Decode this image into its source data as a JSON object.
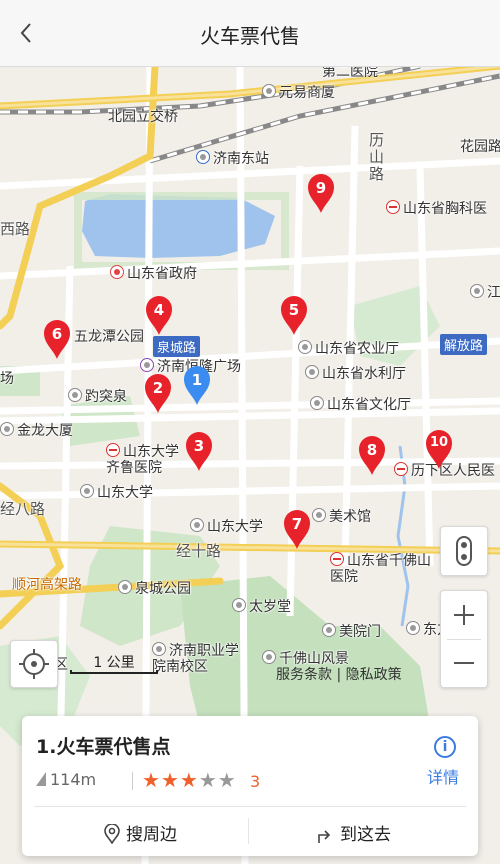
{
  "header": {
    "title": "火车票代售"
  },
  "map": {
    "labels": {
      "beiyuan": "北园立交桥",
      "dier": "第二医院",
      "yuanyi": "元易商厦",
      "jinandong": "济南东站",
      "huayuan": "花园路",
      "lishan": "历山路",
      "xiongke": "山东省胸科医",
      "xilu": "西路",
      "zhengfu": "山东省政府",
      "wulongtan": "五龙潭公园",
      "quancheng_road": "泉城路",
      "jiefang": "解放路",
      "hengLong": "济南恒隆广场",
      "nongye": "山东省农业厅",
      "shuili": "山东省水利厅",
      "baotu": "趵突泉",
      "wenhua": "山东省文化厅",
      "chang": "场",
      "jinlong": "金龙大厦",
      "qilu": "山东大学齐鲁医院",
      "renmin": "历下区人民医",
      "shanda": "山东大学",
      "shanda2": "山东大学",
      "meishu": "美术馆",
      "jingba": "经八路",
      "jingshi": "经十路",
      "qianfo": "山东省千佛山医院",
      "shunhe": "顺河高架路",
      "quanchenggy": "泉城公园",
      "taisui": "太岁堂",
      "zhiye": "济南职业学院南校区",
      "meiyuan": "美院门",
      "qianfoshan": "千佛山风景",
      "left_region": "区",
      "dongfang": "东方",
      "jiang": "江"
    },
    "pins": [
      "1",
      "2",
      "3",
      "4",
      "5",
      "6",
      "7",
      "8",
      "9",
      "10"
    ],
    "scale": "1 公里",
    "attribution": "服务条款 | 隐私政策"
  },
  "card": {
    "title": "1.火车票代售点",
    "detail_label": "详情",
    "distance": "114m",
    "rating": 3,
    "rating_text": "3",
    "action_nearby": "搜周边",
    "action_route": "到这去"
  },
  "colors": {
    "accent": "#3b7be0",
    "pin_red": "#e8222b",
    "pin_blue": "#3b8cf0",
    "star": "#f0602b"
  }
}
